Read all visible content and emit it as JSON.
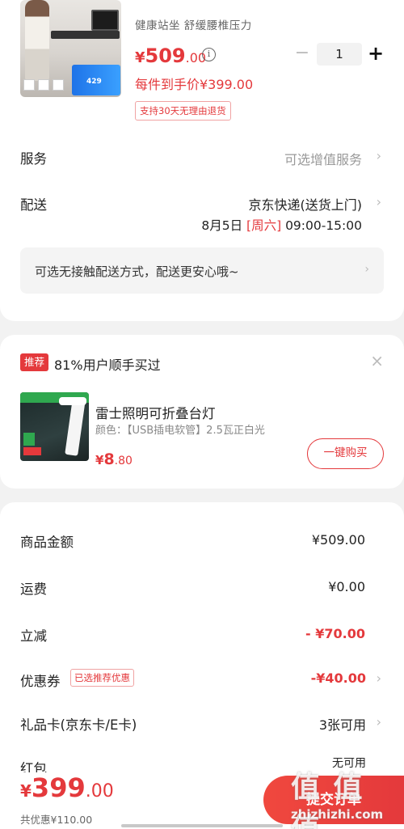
{
  "product": {
    "subtitle": "健康站坐 舒缓腰椎压力",
    "price_symbol": "¥",
    "price_int": "509",
    "price_dec": ".00",
    "info_icon": "i",
    "every_piece_price": "每件到手价¥399.00",
    "return_tag": "支持30天无理由退货",
    "image_promo_num": "429",
    "quantity": "1",
    "qty_minus": "−",
    "qty_plus": "+"
  },
  "service": {
    "label": "服务",
    "value": "可选增值服务"
  },
  "delivery": {
    "label": "配送",
    "method": "京东快递(送货上门)",
    "date": "8月5日",
    "weekday": "[周六]",
    "time": "09:00-15:00",
    "hint": "可选无接触配送方式，配送更安心哦~"
  },
  "recommend": {
    "tag": "推荐",
    "title": "81%用户顺手买过",
    "close": "×",
    "item_name": "雷士照明可折叠台灯",
    "item_spec": "颜色：【USB插电软管】2.5瓦正白光",
    "price_symbol": "¥",
    "price_int": "8",
    "price_dec": ".80",
    "buy_label": "一键购买"
  },
  "summary": {
    "goods_label": "商品金额",
    "goods_value": "¥509.00",
    "freight_label": "运费",
    "freight_value": "¥0.00",
    "discount_label": "立减",
    "discount_value": "- ¥70.00",
    "coupon_label": "优惠券",
    "coupon_tag": "已选推荐优惠",
    "coupon_value": "-¥40.00",
    "giftcard_label": "礼品卡(京东卡/E卡)",
    "giftcard_value": "3张可用",
    "redpacket_label": "红包",
    "redpacket_value": "无可用"
  },
  "bottom": {
    "price_symbol": "¥",
    "total_int": "399",
    "total_dec": ".00",
    "total_saving": "共优惠¥110.00",
    "submit_label": "提交订单"
  },
  "watermark": {
    "main": "值 值 值",
    "site": "zhizhizhi.com"
  },
  "icons": {
    "chevron": "›"
  },
  "colors": {
    "accent": "#e4393c",
    "muted": "#999999",
    "page_bg": "#f2f2f2"
  }
}
